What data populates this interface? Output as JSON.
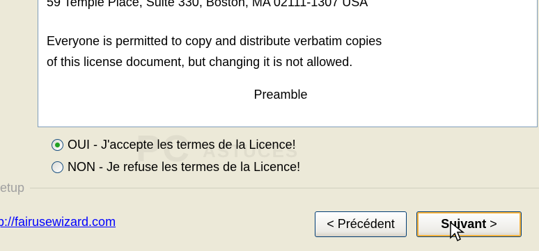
{
  "license": {
    "address_line": "59 Temple Place, Suite 330, Boston, MA 02111-1307 USA",
    "line1": "Everyone is permitted to copy and distribute verbatim copies",
    "line2": "of this license document, but changing it is not allowed.",
    "preamble": "Preamble"
  },
  "watermark": {
    "text_big": "PC",
    "text_small": "ASTUCES"
  },
  "options": [
    {
      "label": "OUI - J'accepte les termes de la Licence!",
      "selected": true
    },
    {
      "label": "NON - Je refuse les termes de la Licence!",
      "selected": false
    }
  ],
  "group_label": "etup",
  "link": "p://fairusewizard.com",
  "buttons": {
    "prev": "< Précédent",
    "next_bold": "Suivant",
    "next_rest": " >"
  },
  "colors": {
    "accent_radio": "#21A121",
    "link": "#0000FF",
    "focus_border": "#F8B33C"
  }
}
